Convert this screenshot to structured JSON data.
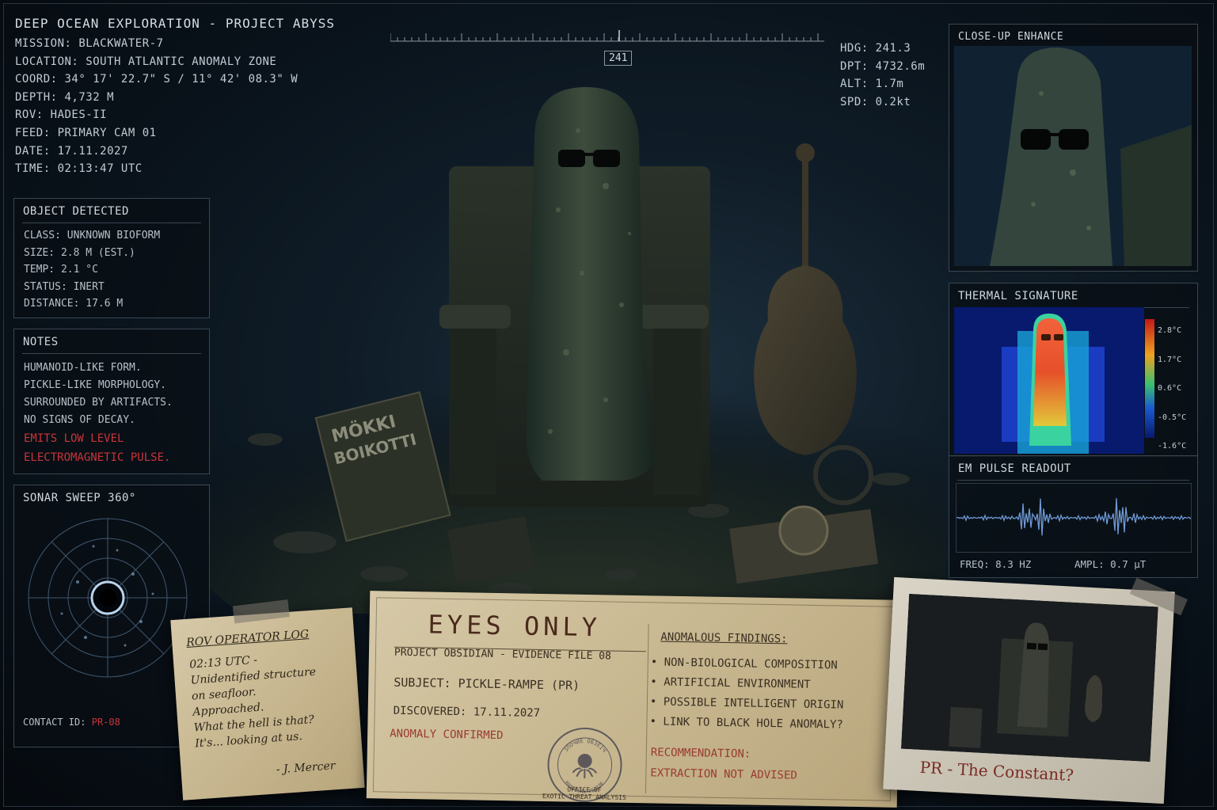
{
  "header": {
    "title": "DEEP OCEAN EXPLORATION - PROJECT ABYSS",
    "lines": [
      "MISSION: BLACKWATER-7",
      "LOCATION: SOUTH ATLANTIC ANOMALY ZONE",
      "COORD: 34° 17' 22.7\" S / 11° 42' 08.3\" W",
      "DEPTH: 4,732 M",
      "ROV: HADES-II",
      "FEED: PRIMARY CAM 01",
      "DATE: 17.11.2027",
      "TIME: 02:13:47 UTC"
    ]
  },
  "compass": {
    "heading": "241"
  },
  "telemetry": [
    "HDG: 241.3",
    "DPT: 4732.6m",
    "ALT: 1.7m",
    "SPD: 0.2kt"
  ],
  "object_detected": {
    "title": "OBJECT DETECTED",
    "lines": [
      "CLASS: UNKNOWN BIOFORM",
      "SIZE: 2.8 M (EST.)",
      "TEMP: 2.1 °C",
      "STATUS: INERT",
      "DISTANCE: 17.6 M"
    ]
  },
  "notes": {
    "title": "NOTES",
    "lines": [
      "HUMANOID-LIKE FORM.",
      "PICKLE-LIKE MORPHOLOGY.",
      "SURROUNDED BY ARTIFACTS.",
      "NO SIGNS OF DECAY."
    ],
    "alert_lines": [
      "EMITS LOW LEVEL",
      "ELECTROMAGNETIC PULSE."
    ]
  },
  "sonar": {
    "title": "SONAR SWEEP 360°",
    "contact_label": "CONTACT ID:",
    "contact_id": "PR-08"
  },
  "closeup": {
    "title": "CLOSE-UP ENHANCE"
  },
  "thermal": {
    "title": "THERMAL SIGNATURE",
    "scale": [
      "2.8°C",
      "1.7°C",
      "0.6°C",
      "-0.5°C",
      "-1.6°C"
    ]
  },
  "em_pulse": {
    "title": "EM PULSE READOUT",
    "freq": "FREQ: 8.3 HZ",
    "ampl": "AMPL: 0.7 μT"
  },
  "scene": {
    "book_line1": "MÖKKI",
    "book_line2": "BOIKOTTI"
  },
  "rov_log": {
    "title": "ROV OPERATOR LOG",
    "lines": [
      "02:13 UTC -",
      "Unidentified structure",
      "on seafloor.",
      "Approached.",
      "What the hell is that?",
      "It's... looking at us."
    ],
    "signature": "- J. Mercer"
  },
  "file": {
    "headline": "EYES ONLY",
    "project": "PROJECT OBSIDIAN - EVIDENCE FILE 08",
    "subject": "SUBJECT: PICKLE-RAMPE (PR)",
    "discovered": "DISCOVERED: 17.11.2027",
    "status": "ANOMALY CONFIRMED",
    "seal_ring_top": "ЗПОЧЙЕ ОБЗЕІЧ",
    "seal_ring_bottom": "ВЯІЗІЄЯЗ УЕІІЛЕ",
    "seal_caption1": "OFFICE OF",
    "seal_caption2": "EXOTIC THREAT ANALYSIS",
    "findings_title": "ANOMALOUS FINDINGS:",
    "findings": [
      "NON-BIOLOGICAL COMPOSITION",
      "ARTIFICIAL ENVIRONMENT",
      "POSSIBLE INTELLIGENT ORIGIN",
      "LINK TO BLACK HOLE ANOMALY?"
    ],
    "recommendation_title": "RECOMMENDATION:",
    "recommendation": "EXTRACTION NOT ADVISED"
  },
  "polaroid": {
    "caption": "PR - The Constant?"
  },
  "colors": {
    "alert": "#c8353a",
    "hud": "#c3ccd4",
    "paper": "#cdbd96",
    "ink": "#3a2f22",
    "em_wave": "#6f9ad6"
  }
}
